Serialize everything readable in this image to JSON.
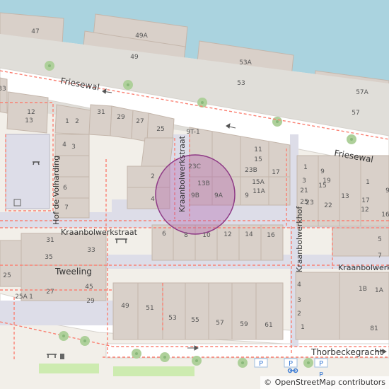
{
  "colors": {
    "water": "#aad3df",
    "land": "#f2efe9",
    "building": "#d9d0c9",
    "building_stroke": "#c4b6ab",
    "road": "#ffffff",
    "pedestrian": "#dddde8",
    "footway": "#fa8072",
    "grass": "#cdebb0",
    "tree": "#aed09a",
    "marker_fill": "#b05ba8",
    "parking": "#3b7bd4"
  },
  "streets": {
    "friesewal_west": "Friesewal",
    "friesewal_east": "Friesewal",
    "kraanbolwerkstraat_vertical": "Kraanbolwerkstraat",
    "kraanbolwerkstraat_horizontal": "Kraanbolwerkstraat",
    "hof_de_volharding": "Hof de Volharding",
    "kraanbolwerkhof": "Kraanbolwerkhof",
    "kraanbolwerk_east": "Kraanbolwerk",
    "thorbeckegracht": "Thorbeckegracht"
  },
  "place_labels": {
    "tweeling": "Tweeling"
  },
  "house_numbers": {
    "boat_47": "47",
    "boat_49a": "49A",
    "boat_49": "49",
    "boat_53a": "53A",
    "boat_53": "53",
    "boat_57a": "57A",
    "boat_57": "57",
    "n33_edge": "33",
    "n12": "12",
    "n13": "13",
    "n1": "1",
    "n2": "2",
    "n4": "4",
    "n3": "3",
    "n6": "6",
    "n7": "7",
    "n31_top": "31",
    "n29_top": "29",
    "n27_top": "27",
    "n25_top": "25",
    "n9t1": "9T-1",
    "n23c": "23C",
    "n13b": "13B",
    "n9b": "9B",
    "n9a": "9A",
    "n9_mid": "9",
    "n2_mid": "2",
    "n4_mid": "4",
    "n11": "11",
    "n15": "15",
    "n23b": "23B",
    "n17": "17",
    "n15a": "15A",
    "n11a": "11A",
    "e1": "1",
    "e9": "9",
    "e3": "3",
    "e21": "21",
    "e25": "25",
    "e23": "23",
    "e19": "19",
    "e15": "15",
    "e13": "13",
    "e22": "22",
    "e17": "17",
    "e12": "12",
    "e1x": "1",
    "e9x": "9",
    "e16": "16",
    "n6_row": "6",
    "n8_row": "8",
    "n10_row": "10",
    "n12_row": "12",
    "n14_row": "14",
    "n16_row": "16",
    "t31": "31",
    "t33": "33",
    "t35": "35",
    "t25": "25",
    "t27": "27",
    "t45": "45",
    "t29": "29",
    "t25a": "25A",
    "t1": "1",
    "s49": "49",
    "s51": "51",
    "s53": "53",
    "s55": "55",
    "s57": "57",
    "s59": "59",
    "s61": "61",
    "k4": "4",
    "k3": "3",
    "k2": "2",
    "k1": "1",
    "k1b": "1B",
    "k1a": "1A",
    "k81": "81",
    "k5": "5",
    "k7": "7"
  },
  "parking": {
    "p1": "P",
    "p2": "P",
    "p3": "P",
    "p4": "P"
  },
  "icons": [
    "picnic-table-icon",
    "waste-basket-icon",
    "bench-icon",
    "bicycle-parking-icon",
    "one-way-arrow-icon",
    "playground-icon"
  ],
  "attribution": {
    "symbol": "©",
    "text": "OpenStreetMap contributors"
  }
}
